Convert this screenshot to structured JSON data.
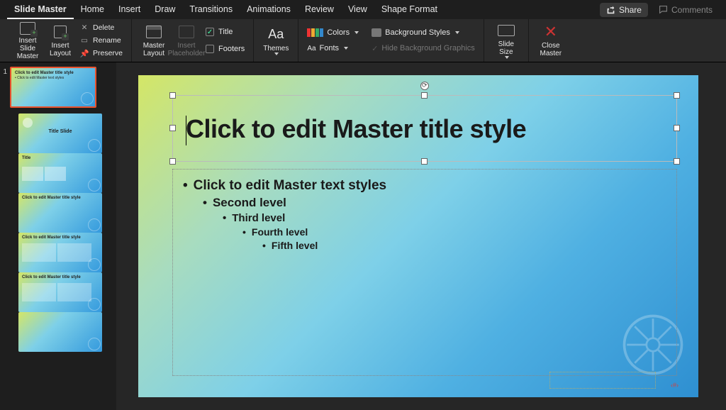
{
  "tabs": {
    "items": [
      "Slide Master",
      "Home",
      "Insert",
      "Draw",
      "Transitions",
      "Animations",
      "Review",
      "View",
      "Shape Format"
    ],
    "active_index": 0
  },
  "topright": {
    "share": "Share",
    "comments": "Comments"
  },
  "ribbon": {
    "insert_slide_master": "Insert Slide\nMaster",
    "insert_layout": "Insert\nLayout",
    "delete": "Delete",
    "rename": "Rename",
    "preserve": "Preserve",
    "master_layout": "Master\nLayout",
    "insert_placeholder": "Insert\nPlaceholder",
    "title_chk": "Title",
    "footers_chk": "Footers",
    "themes": "Themes",
    "colors": "Colors",
    "fonts": "Fonts",
    "bg_styles": "Background Styles",
    "hide_bg": "Hide Background Graphics",
    "slide_size": "Slide\nSize",
    "close_master": "Close\nMaster"
  },
  "panel": {
    "master_num": "1",
    "thumb_titles": {
      "t0": "Click to edit Master title style",
      "t0s": "• Click to edit Master text styles",
      "t1": "Title Slide",
      "t2": "Title",
      "t3": "Click to edit Master title style",
      "t4": "Click to edit Master title style",
      "t5": "Click to edit Master title style"
    }
  },
  "slide": {
    "title": "Click to edit Master title style",
    "bullets": {
      "l1": "Click to edit Master text styles",
      "l2": "Second level",
      "l3": "Third level",
      "l4": "Fourth level",
      "l5": "Fifth level"
    }
  }
}
